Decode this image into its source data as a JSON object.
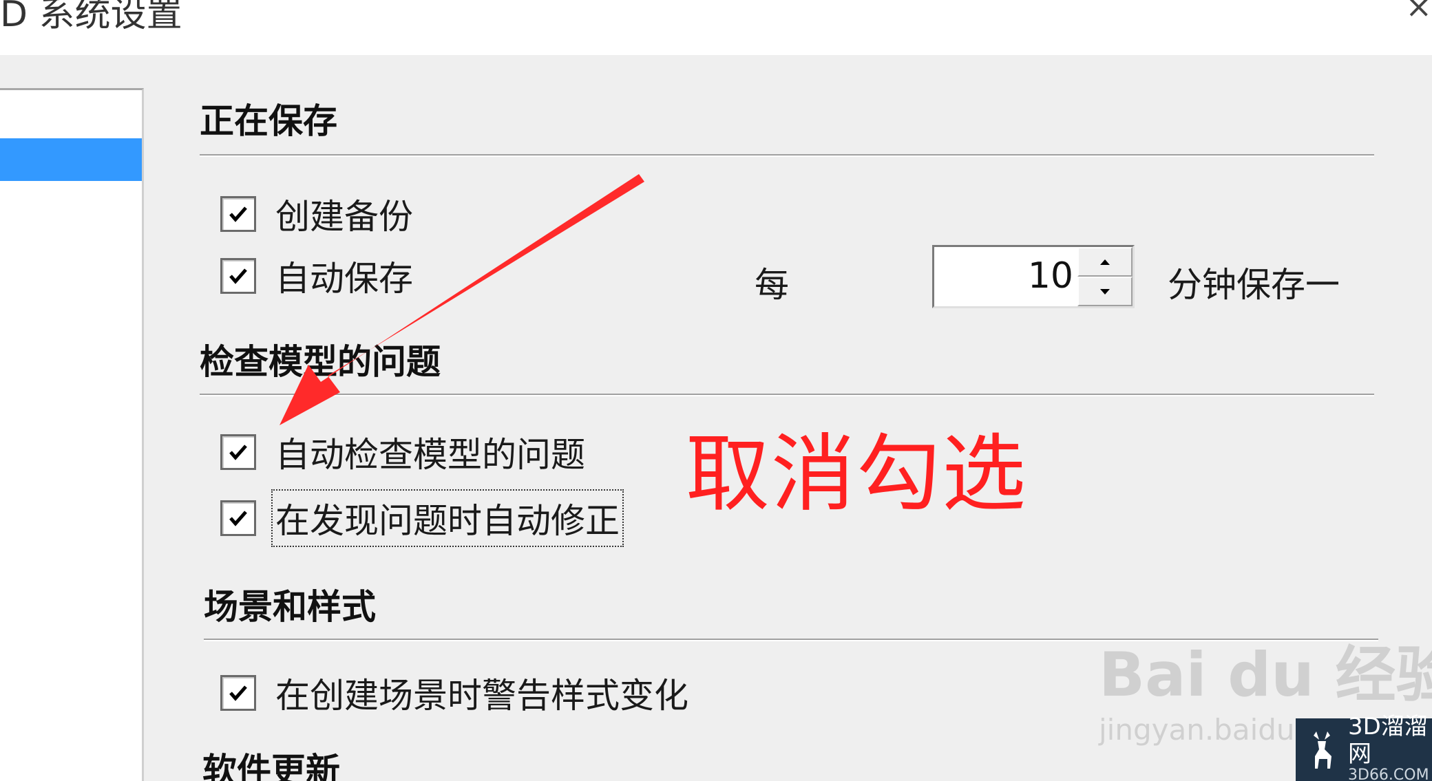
{
  "window": {
    "title": "D 系统设置",
    "close_glyph": "×"
  },
  "sections": {
    "saving": {
      "title": "正在保存",
      "create_backup": {
        "label": "创建备份",
        "checked": true
      },
      "auto_save": {
        "label": "自动保存",
        "checked": true
      },
      "every_label": "每",
      "interval_value": "10",
      "minutes_label": "分钟保存一"
    },
    "model_check": {
      "title": "检查模型的问题",
      "auto_check": {
        "label": "自动检查模型的问题",
        "checked": true
      },
      "auto_fix": {
        "label": "在发现问题时自动修正",
        "checked": true
      }
    },
    "scenes_styles": {
      "title": "场景和样式",
      "warn_style": {
        "label": "在创建场景时警告样式变化",
        "checked": true
      }
    },
    "software_update": {
      "title": "软件更新"
    }
  },
  "annotation": {
    "text": "取消勾选",
    "color": "#ff2020"
  },
  "watermarks": {
    "baidu": "Bai du 经验",
    "baidu_url": "jingyan.baidu",
    "logo_cn": "3D溜溜网",
    "logo_en": "3D66.COM"
  },
  "colors": {
    "dialog_bg": "#efefef",
    "selection": "#3399ff",
    "annotation_red": "#ff2020",
    "logo_bg": "#1f3347"
  }
}
